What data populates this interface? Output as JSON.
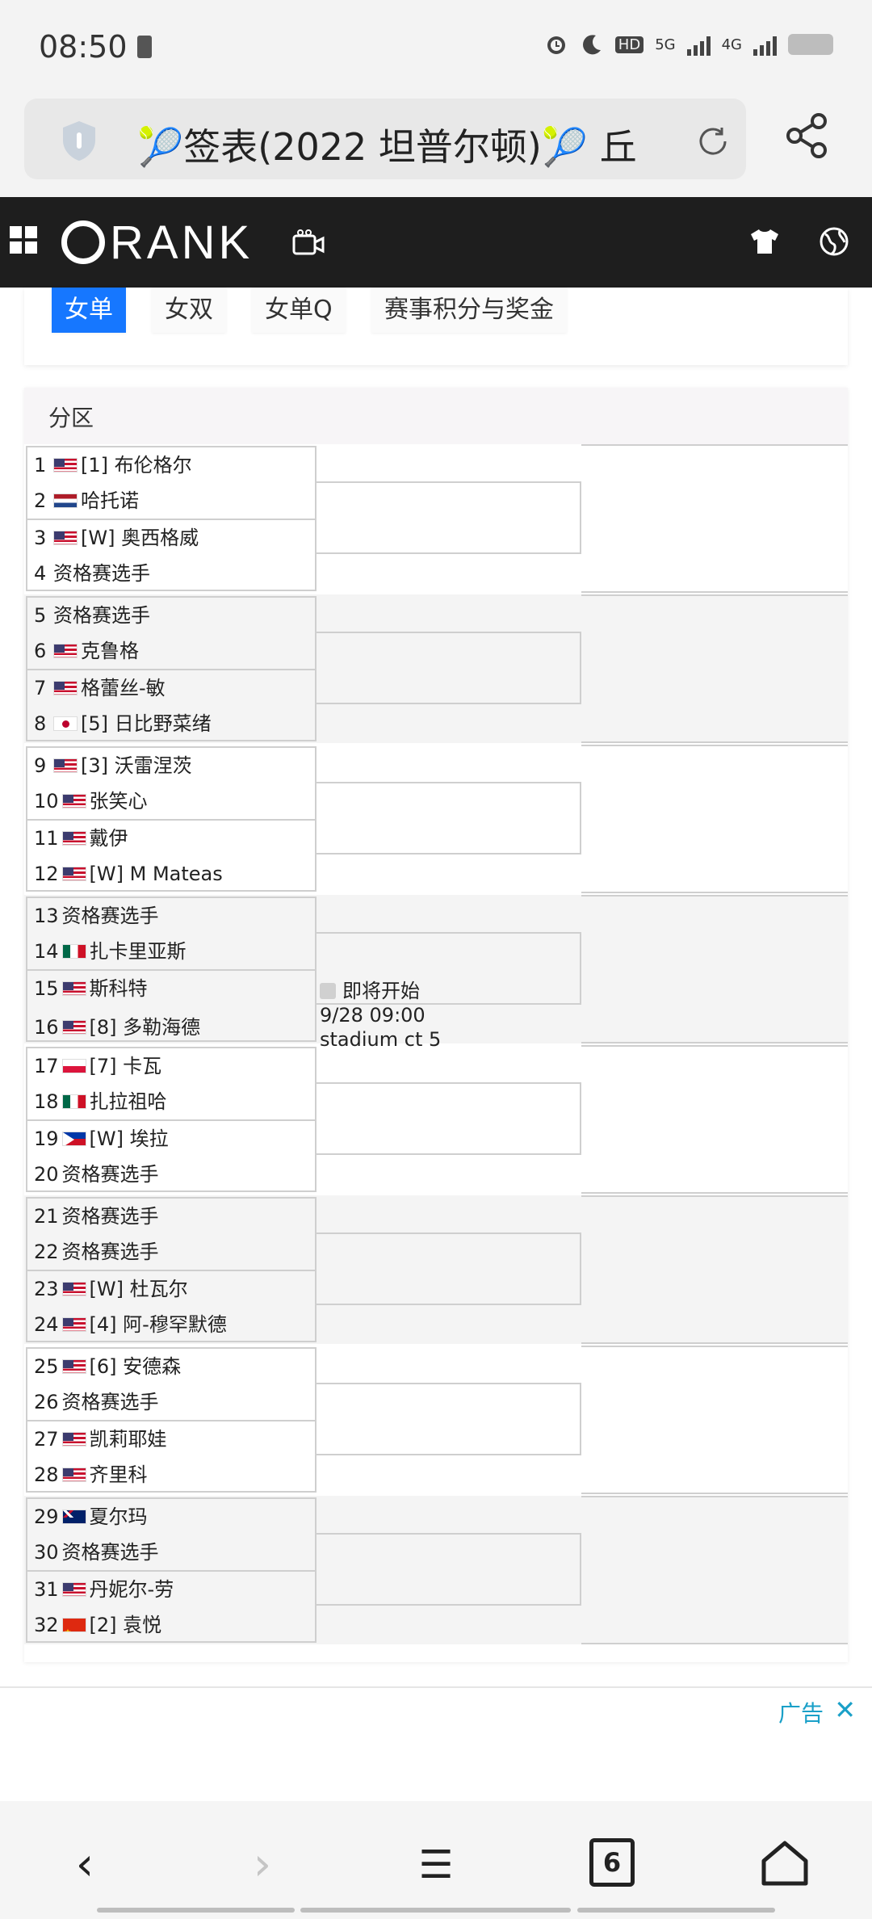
{
  "status_bar": {
    "time": "08:50",
    "net5g": "5G",
    "net4g": "4G",
    "hd": "HD"
  },
  "url_bar": {
    "title": "🎾签表(2022 坦普尔顿)🎾 丘"
  },
  "site": {
    "logo": "RANK"
  },
  "tabs": [
    {
      "label": "女单",
      "active": true
    },
    {
      "label": "女双",
      "active": false
    },
    {
      "label": "女单Q",
      "active": false
    },
    {
      "label": "赛事积分与奖金",
      "active": false
    }
  ],
  "draw": {
    "header": "分区",
    "players": [
      {
        "num": "1",
        "flag": "us",
        "name": "[1] 布伦格尔"
      },
      {
        "num": "2",
        "flag": "nl",
        "name": "哈托诺"
      },
      {
        "num": "3",
        "flag": "us",
        "name": "[W] 奥西格威"
      },
      {
        "num": "4",
        "flag": "",
        "name": "资格赛选手"
      },
      {
        "num": "5",
        "flag": "",
        "name": "资格赛选手"
      },
      {
        "num": "6",
        "flag": "us",
        "name": "克鲁格"
      },
      {
        "num": "7",
        "flag": "us",
        "name": "格蕾丝-敏"
      },
      {
        "num": "8",
        "flag": "jp",
        "name": "[5] 日比野菜绪"
      },
      {
        "num": "9",
        "flag": "us",
        "name": "[3] 沃雷涅茨"
      },
      {
        "num": "10",
        "flag": "us",
        "name": "张笑心"
      },
      {
        "num": "11",
        "flag": "us",
        "name": "戴伊"
      },
      {
        "num": "12",
        "flag": "us",
        "name": "[W] M Mateas"
      },
      {
        "num": "13",
        "flag": "",
        "name": "资格赛选手"
      },
      {
        "num": "14",
        "flag": "mx",
        "name": "扎卡里亚斯"
      },
      {
        "num": "15",
        "flag": "us",
        "name": "斯科特"
      },
      {
        "num": "16",
        "flag": "us",
        "name": "[8] 多勒海德"
      },
      {
        "num": "17",
        "flag": "pl",
        "name": "[7] 卡瓦"
      },
      {
        "num": "18",
        "flag": "mx",
        "name": "扎拉祖哈"
      },
      {
        "num": "19",
        "flag": "ph",
        "name": "[W] 埃拉"
      },
      {
        "num": "20",
        "flag": "",
        "name": "资格赛选手"
      },
      {
        "num": "21",
        "flag": "",
        "name": "资格赛选手"
      },
      {
        "num": "22",
        "flag": "",
        "name": "资格赛选手"
      },
      {
        "num": "23",
        "flag": "us",
        "name": "[W] 杜瓦尔"
      },
      {
        "num": "24",
        "flag": "us",
        "name": "[4] 阿-穆罕默德"
      },
      {
        "num": "25",
        "flag": "us",
        "name": "[6] 安德森"
      },
      {
        "num": "26",
        "flag": "",
        "name": "资格赛选手"
      },
      {
        "num": "27",
        "flag": "us",
        "name": "凯莉耶娃"
      },
      {
        "num": "28",
        "flag": "us",
        "name": "齐里科"
      },
      {
        "num": "29",
        "flag": "au",
        "name": "夏尔玛"
      },
      {
        "num": "30",
        "flag": "",
        "name": "资格赛选手"
      },
      {
        "num": "31",
        "flag": "us",
        "name": "丹妮尔-劳"
      },
      {
        "num": "32",
        "flag": "cn",
        "name": "[2] 袁悦"
      }
    ],
    "match": {
      "status": "即将开始",
      "time": "9/28 09:00",
      "court": "stadium ct 5"
    }
  },
  "ad": {
    "label": "广告",
    "close": "✕"
  },
  "bottom_nav": {
    "back": "‹",
    "forward": "›",
    "menu": "☰",
    "tab_count": "6"
  }
}
